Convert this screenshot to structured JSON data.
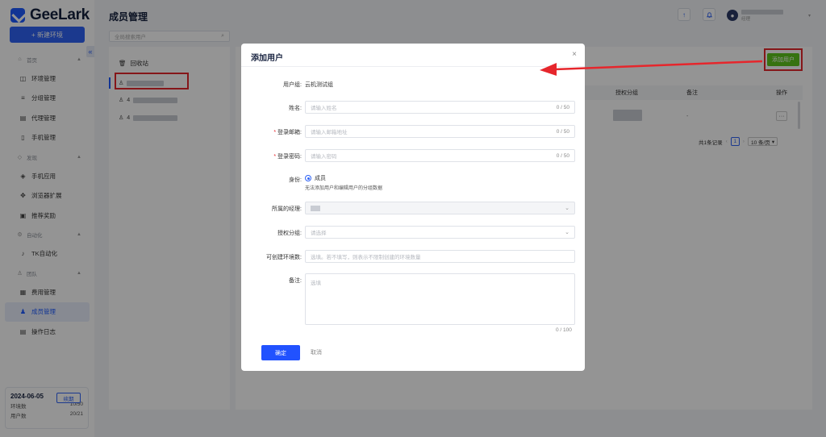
{
  "app": {
    "logo": "GeeLark",
    "page_title": "成员管理"
  },
  "sidebar": {
    "new_env_label": "+ 新建环境",
    "collapse_glyph": "«",
    "groups": [
      {
        "label": "首页",
        "items": [
          {
            "label": "环境管理",
            "icon": "browser-icon"
          },
          {
            "label": "分组管理",
            "icon": "list-icon"
          },
          {
            "label": "代理管理",
            "icon": "proxy-icon"
          },
          {
            "label": "手机管理",
            "icon": "phone-icon"
          }
        ]
      },
      {
        "label": "发现",
        "items": [
          {
            "label": "手机应用",
            "icon": "app-icon"
          },
          {
            "label": "浏览器扩展",
            "icon": "extension-icon"
          },
          {
            "label": "推荐奖励",
            "icon": "gift-icon"
          }
        ]
      },
      {
        "label": "自动化",
        "items": [
          {
            "label": "TK自动化",
            "icon": "tiktok-icon"
          }
        ]
      },
      {
        "label": "团队",
        "items": [
          {
            "label": "费用管理",
            "icon": "billing-icon"
          },
          {
            "label": "成员管理",
            "icon": "members-icon",
            "active": true
          },
          {
            "label": "操作日志",
            "icon": "log-icon"
          }
        ]
      }
    ],
    "quota": {
      "date": "2024-06-05",
      "renew_label": "续期",
      "env_label": "环境数",
      "env_value": "10/50",
      "user_label": "用户数",
      "user_value": "20/21"
    }
  },
  "header": {
    "upload_glyph": "↑",
    "bell_glyph": "🔔",
    "user_role": "经理"
  },
  "member_list": {
    "search_placeholder": "全局搜索用户",
    "recycle_label": "回收站",
    "member_prefix": "4"
  },
  "main": {
    "add_user_label": "添加用户",
    "columns": [
      "授权分组",
      "备注",
      "操作"
    ],
    "row": {
      "remark": "-",
      "more": "···"
    },
    "pager": {
      "total": "共1条记录",
      "page": "1",
      "size": "10 条/页"
    }
  },
  "modal": {
    "title": "添加用户",
    "close_glyph": "×",
    "fields": {
      "group": {
        "label": "用户组:",
        "value": "云机测试组"
      },
      "name": {
        "label": "姓名:",
        "placeholder": "请输入姓名",
        "counter": "0 / 50"
      },
      "email": {
        "label": "登录邮箱:",
        "placeholder": "请输入邮箱地址",
        "counter": "0 / 50"
      },
      "password": {
        "label": "登录密码:",
        "placeholder": "请输入密码",
        "counter": "0 / 50"
      },
      "role": {
        "label": "身份:",
        "option": "成员",
        "hint": "无法添加用户和编辑用户的分组数据"
      },
      "manager": {
        "label": "所属的经理:"
      },
      "auth_group": {
        "label": "授权分组:",
        "placeholder": "请选择"
      },
      "env_limit": {
        "label": "可创建环境数:",
        "placeholder": "选填。若不填写，则表示不限制创建的环境数量"
      },
      "remark": {
        "label": "备注:",
        "placeholder": "选填",
        "counter": "0 / 100"
      }
    },
    "ok_label": "确定",
    "cancel_label": "取消"
  },
  "colors": {
    "accent": "#2f63f5",
    "add_button": "#5dc41d",
    "annotation": "#e6262c"
  }
}
